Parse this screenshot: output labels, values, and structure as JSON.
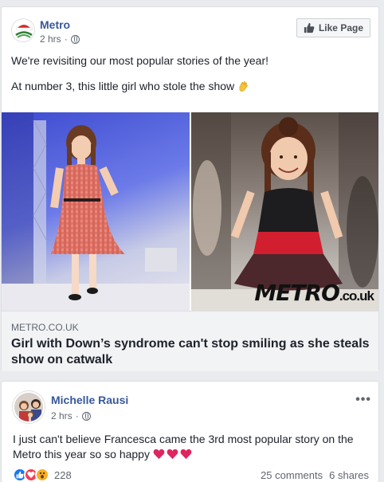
{
  "post": {
    "page_name": "Metro",
    "time": "2 hrs",
    "like_page_label": "Like Page",
    "text_line1": "We're revisiting our most popular stories of the year!",
    "text_line2": "At number 3, this little girl who stole the show",
    "link": {
      "domain": "METRO.CO.UK",
      "title": "Girl with Down’s syndrome can't stop smiling as she steals show on catwalk"
    },
    "image_watermark": "METRO.co.uk",
    "icons": {
      "avatar": "metro-christmas-logo",
      "privacy": "globe-icon",
      "like": "thumbs-up-icon",
      "emoji": "clapping-hands-emoji"
    }
  },
  "comment": {
    "author": "Michelle Rausi",
    "time": "2 hrs",
    "text": "I just can't believe Francesca came the 3rd most popular story on the Metro this year so so happy",
    "emoji": "three-red-hearts",
    "reaction_count": "228",
    "comments_label": "25 comments",
    "shares_label": "6 shares",
    "more_label": "•••"
  },
  "colors": {
    "link_blue": "#385898",
    "like_blue": "#1877f2",
    "love_red": "#f33e58",
    "haha_yellow": "#f7b125",
    "background": "#e9ebee"
  }
}
